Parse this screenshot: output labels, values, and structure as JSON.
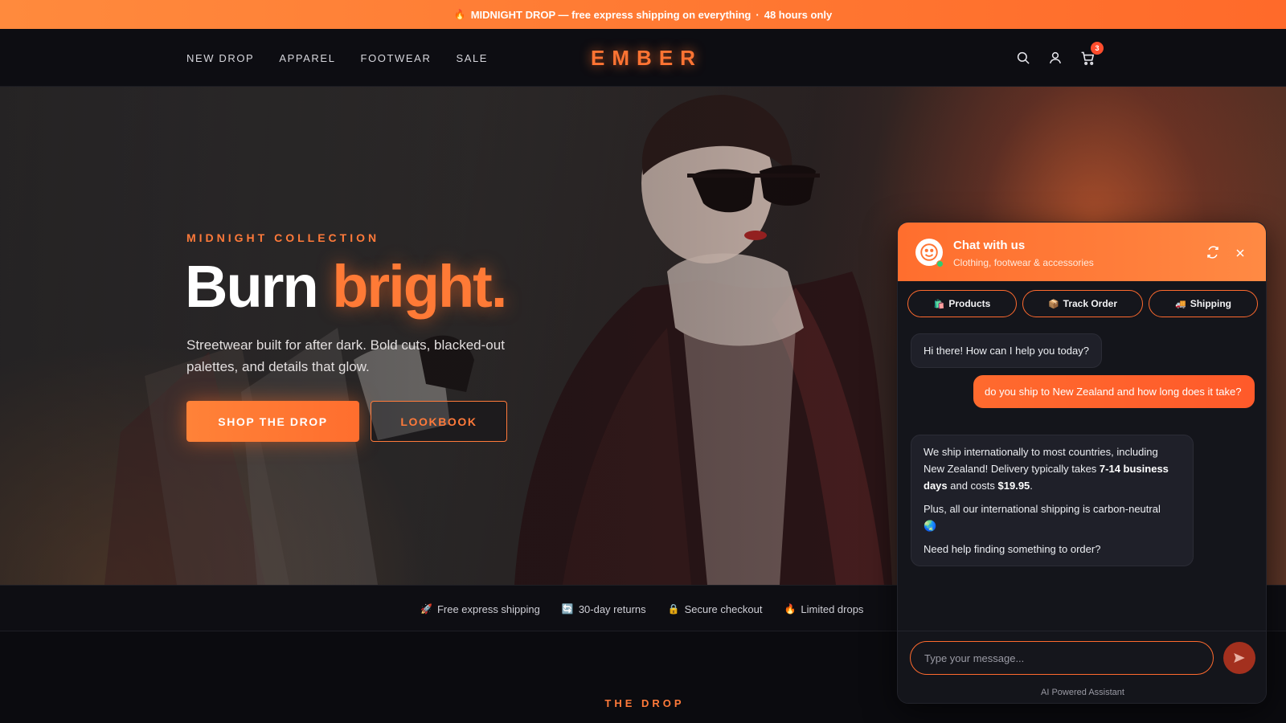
{
  "announcement": {
    "icon": "flame-icon",
    "text": "MIDNIGHT DROP — free express shipping on everything",
    "separator": "·",
    "suffix": "48 hours only"
  },
  "header": {
    "nav": [
      "NEW DROP",
      "APPAREL",
      "FOOTWEAR",
      "SALE"
    ],
    "logo": "EMBER",
    "cart_count": "3",
    "icons": [
      "search-icon",
      "account-icon",
      "cart-icon"
    ]
  },
  "hero": {
    "eyebrow": "MIDNIGHT COLLECTION",
    "title_white": "Burn",
    "title_accent": "bright.",
    "subtitle": "Streetwear built for after dark. Bold cuts, blacked-out palettes, and details that glow.",
    "primary_cta": "SHOP THE DROP",
    "secondary_cta": "LOOKBOOK"
  },
  "features": [
    {
      "icon": "rocket-icon",
      "glyph": "🚀",
      "label": "Free express shipping"
    },
    {
      "icon": "return-icon",
      "glyph": "🔄",
      "label": "30-day returns"
    },
    {
      "icon": "lock-icon",
      "glyph": "🔒",
      "label": "Secure checkout"
    },
    {
      "icon": "fire-icon",
      "glyph": "🔥",
      "label": "Limited drops"
    }
  ],
  "section_title": "THE DROP",
  "chat": {
    "title": "Chat with us",
    "subtitle": "Clothing, footwear & accessories",
    "quick_actions": [
      {
        "icon": "shopping-bags-icon",
        "glyph": "🛍️",
        "label": "Products"
      },
      {
        "icon": "package-icon",
        "glyph": "📦",
        "label": "Track Order"
      },
      {
        "icon": "truck-icon",
        "glyph": "🚚",
        "label": "Shipping"
      }
    ],
    "messages": {
      "greeting": "Hi there! How can I help you today?",
      "user": "do you ship to New Zealand and how long does it take?",
      "reply_part1": "We ship internationally to most countries, including New Zealand! Delivery typically takes ",
      "reply_bold_days": "7-14 business days",
      "reply_part2": " and costs ",
      "reply_bold_price": "$19.95",
      "reply_part3": ".",
      "reply_carbon": "Plus, all our international shipping is carbon-neutral",
      "reply_carbon_glyph": "🌏",
      "reply_help": "Need help finding something to order?"
    },
    "input_placeholder": "Type your message...",
    "powered_by": "AI Powered Assistant"
  },
  "colors": {
    "accent": "#ff7433",
    "background": "#0b0b0f",
    "chat_panel": "#14151b",
    "online": "#2ecc71"
  }
}
